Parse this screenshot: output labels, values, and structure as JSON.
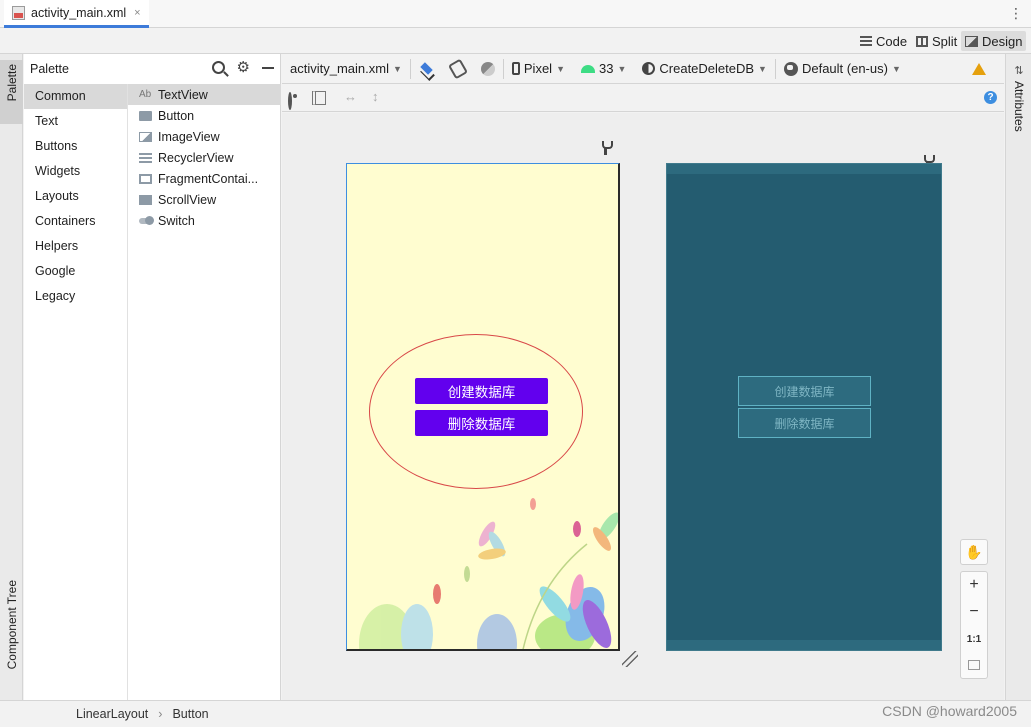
{
  "editor_tab": {
    "filename": "activity_main.xml",
    "close": "×"
  },
  "modes": {
    "code": "Code",
    "split": "Split",
    "design": "Design",
    "active": "Design"
  },
  "left_strip": {
    "palette_tab": "Palette",
    "component_tree_tab": "Component Tree"
  },
  "palette": {
    "title": "Palette",
    "categories": [
      "Common",
      "Text",
      "Buttons",
      "Widgets",
      "Layouts",
      "Containers",
      "Helpers",
      "Google",
      "Legacy"
    ],
    "selected_category": "Common",
    "widgets": [
      {
        "label": "TextView",
        "icon": "textview-icon"
      },
      {
        "label": "Button",
        "icon": "button-icon"
      },
      {
        "label": "ImageView",
        "icon": "imageview-icon"
      },
      {
        "label": "RecyclerView",
        "icon": "recyclerview-icon"
      },
      {
        "label": "FragmentContai...",
        "icon": "fragmentcontainer-icon"
      },
      {
        "label": "ScrollView",
        "icon": "scrollview-icon"
      },
      {
        "label": "Switch",
        "icon": "switch-icon"
      }
    ],
    "ab_glyph": "Ab"
  },
  "toolbar": {
    "file": "activity_main.xml",
    "device": "Pixel",
    "api": "33",
    "theme": "CreateDeleteDB",
    "locale": "Default (en-us)"
  },
  "design_preview": {
    "btn_create": "创建数据库",
    "btn_delete": "删除数据库",
    "background_color": "#fffdd0",
    "button_color": "#6200ee"
  },
  "blueprint": {
    "btn_create": "创建数据库",
    "btn_delete": "删除数据库",
    "background_color": "#245c70"
  },
  "zoom_controls": {
    "zoom_in": "+",
    "zoom_out": "−",
    "actual_size": "1:1"
  },
  "right_strip": {
    "attributes_tab": "Attributes"
  },
  "breadcrumb": {
    "parent": "LinearLayout",
    "separator": "›",
    "child": "Button"
  },
  "watermark": "CSDN @howard2005"
}
